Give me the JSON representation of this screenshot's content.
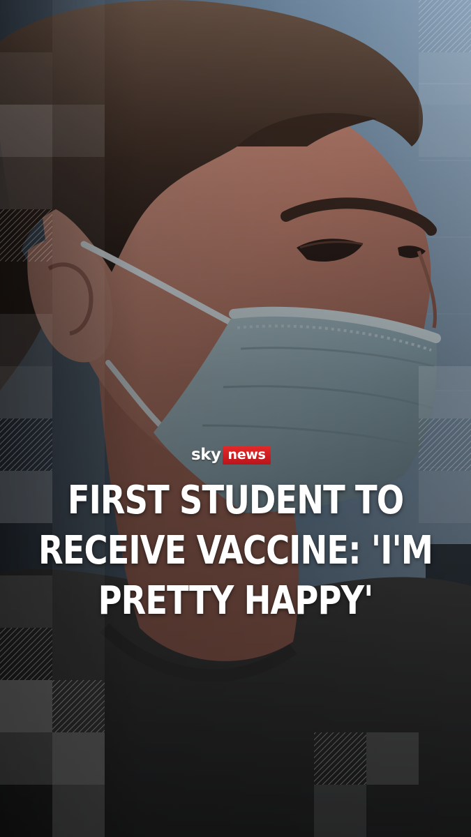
{
  "brand": {
    "logo_primary": "sky",
    "logo_secondary": "news",
    "logo_accent_color": "#d11a21"
  },
  "headline": {
    "lines": [
      "FIRST STUDENT TO",
      "RECEIVE VACCINE: 'I'M",
      "PRETTY HAPPY'"
    ]
  }
}
